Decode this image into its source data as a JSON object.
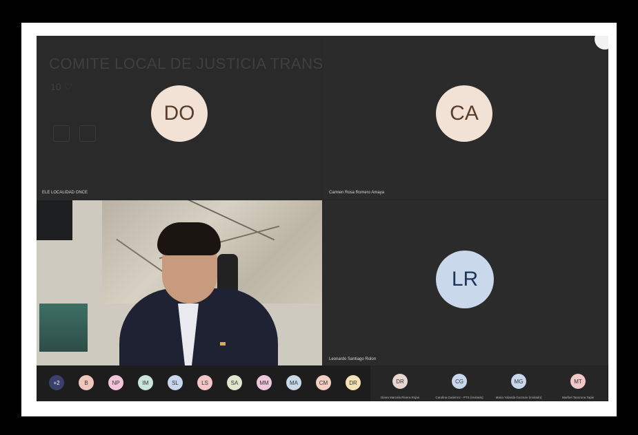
{
  "meeting": {
    "title": "COMITE LOCAL DE JUSTICIA TRANSICIONAL SUBA - SEGUNDA SESION",
    "stats": "10 ♡"
  },
  "tiles": [
    {
      "initials": "DO",
      "name": "ELE LOCALIDAD ONCE"
    },
    {
      "initials": "CA",
      "name": "Carmen Rosa Romero Amaya"
    },
    {
      "initials": "",
      "name": ""
    },
    {
      "initials": "LR",
      "name": "Leonardo Santiago Rolon"
    }
  ],
  "strip": {
    "more": "+2",
    "chips": [
      "B",
      "NP",
      "IM",
      "SL",
      "LS",
      "SA",
      "MM",
      "MA",
      "CM",
      "DR"
    ],
    "cells": [
      {
        "initials": "DR",
        "name": "Diana Marcela Rivera Rojas"
      },
      {
        "initials": "CG",
        "name": "Carolina Gutierrez - PTS (Invitado)"
      },
      {
        "initials": "MG",
        "name": "Maria Yolanda Guzman (Invitado)"
      },
      {
        "initials": "MT",
        "name": "Maribel Tarazona Tapie"
      }
    ]
  }
}
